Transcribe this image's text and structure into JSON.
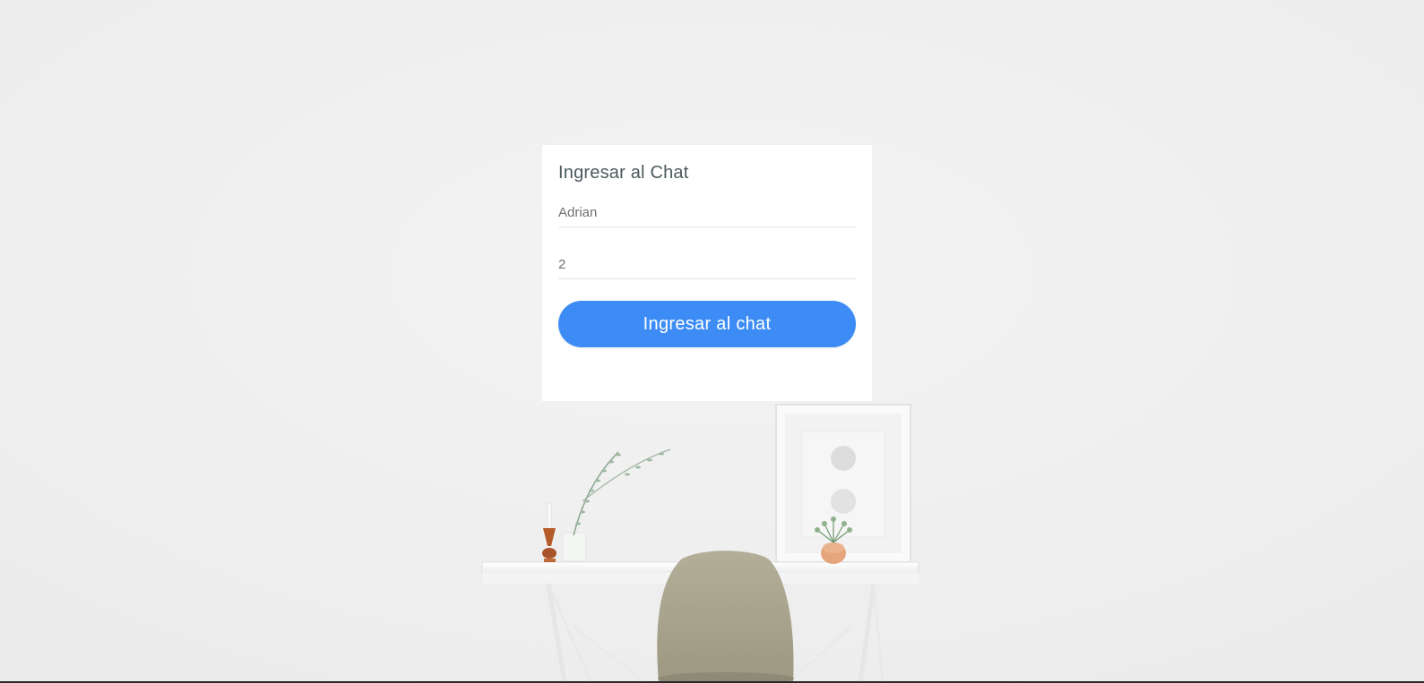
{
  "login": {
    "title": "Ingresar al Chat",
    "name_value": "Adrian",
    "room_value": "2",
    "submit_label": "Ingresar al chat"
  },
  "colors": {
    "background": "#efefef",
    "card": "#ffffff",
    "button": "#3d8cf6",
    "title_text": "#4a5a5c"
  }
}
